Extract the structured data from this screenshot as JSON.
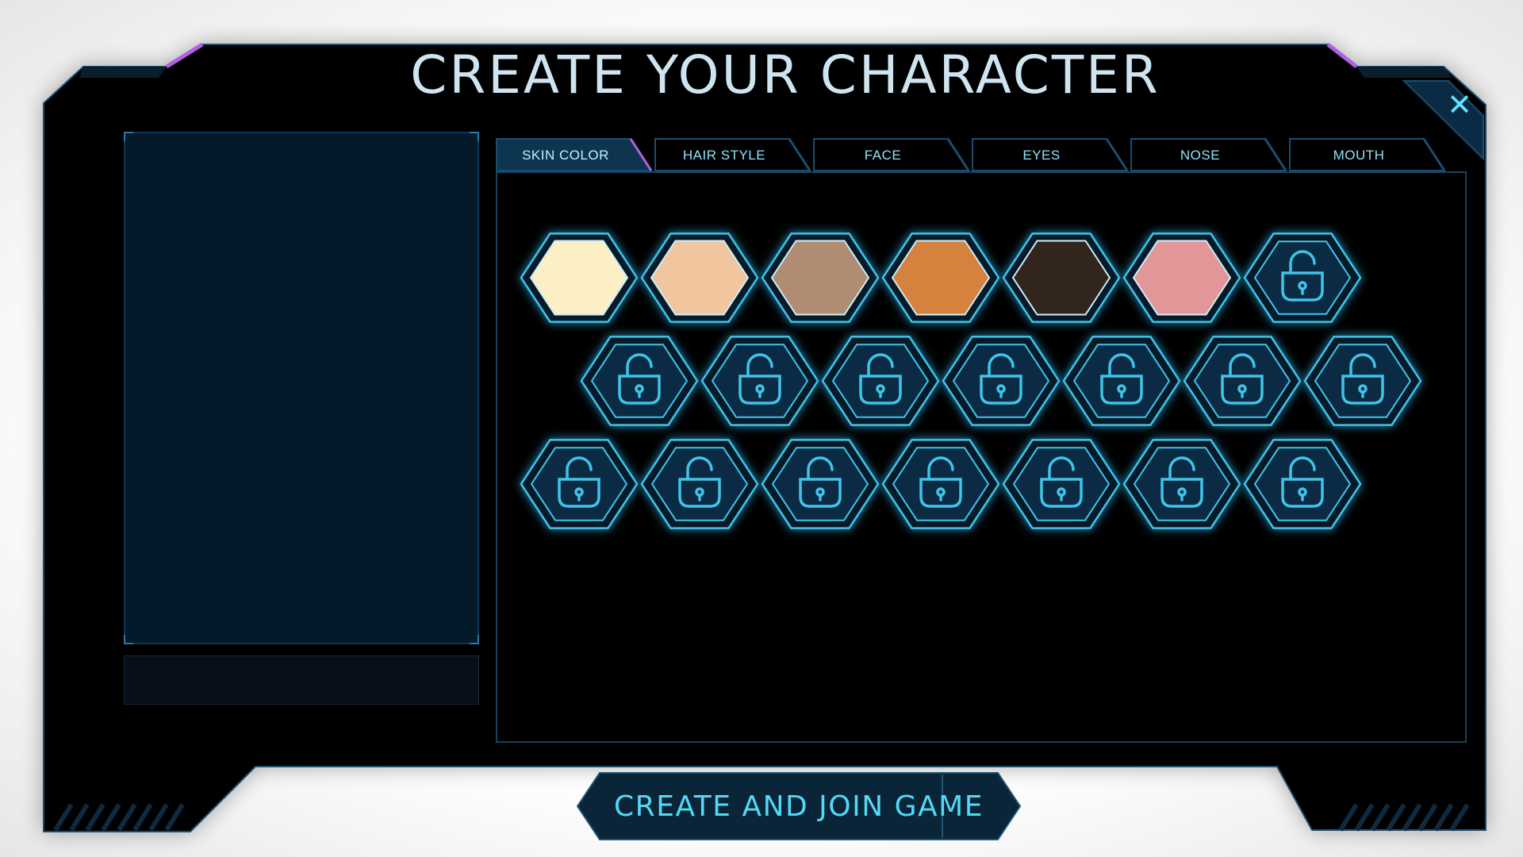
{
  "title": "CREATE YOUR CHARACTER",
  "close_label": "✕",
  "tabs": [
    {
      "label": "SKIN COLOR",
      "active": true
    },
    {
      "label": "HAIR STYLE",
      "active": false
    },
    {
      "label": "FACE",
      "active": false
    },
    {
      "label": "EYES",
      "active": false
    },
    {
      "label": "NOSE",
      "active": false
    },
    {
      "label": "MOUTH",
      "active": false
    }
  ],
  "skin_colors": [
    "#fcefc6",
    "#f1c69f",
    "#b08c73",
    "#d6823f",
    "#31251e",
    "#e29698"
  ],
  "locked_slots": 15,
  "join_button": "CREATE AND JOIN GAME",
  "colors": {
    "accent": "#3fc4ea",
    "accent_bright": "#63e2ff",
    "purple": "#b060e0",
    "frame_border": "#1b4d6f",
    "panel_bg": "#04192a",
    "lock_fill": "#0b2b44"
  }
}
